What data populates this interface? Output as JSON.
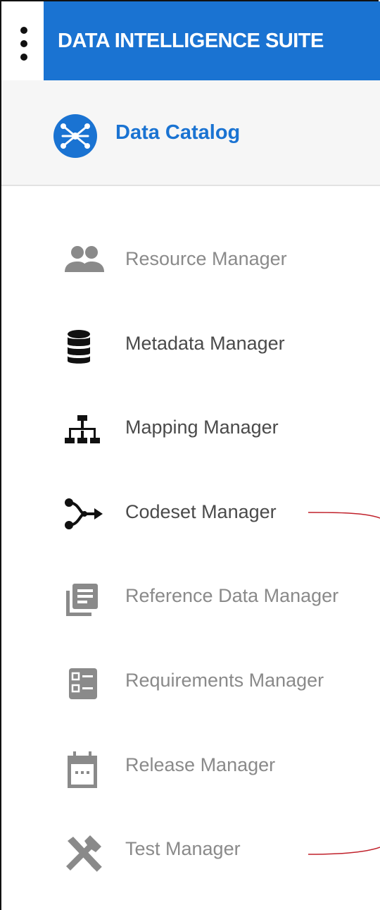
{
  "app": {
    "title": "DATA INTELLIGENCE SUITE"
  },
  "catalog": {
    "label": "Data Catalog",
    "icon": "data-catalog-icon"
  },
  "menu": {
    "items": [
      {
        "label": "Resource Manager",
        "icon": "users-icon",
        "tone": "gray"
      },
      {
        "label": "Metadata Manager",
        "icon": "database-icon",
        "tone": "dark"
      },
      {
        "label": "Mapping Manager",
        "icon": "hierarchy-icon",
        "tone": "dark"
      },
      {
        "label": "Codeset Manager",
        "icon": "merge-arrow-icon",
        "tone": "dark"
      },
      {
        "label": "Reference Data Manager",
        "icon": "library-books-icon",
        "tone": "gray"
      },
      {
        "label": "Requirements Manager",
        "icon": "checklist-icon",
        "tone": "gray"
      },
      {
        "label": "Release Manager",
        "icon": "calendar-icon",
        "tone": "gray"
      },
      {
        "label": "Test Manager",
        "icon": "tools-icon",
        "tone": "gray"
      }
    ]
  },
  "colors": {
    "brand": "#1a73d2",
    "annotation": "#c0202a",
    "icon_gray": "#8a8a8a",
    "icon_dark": "#111111"
  }
}
